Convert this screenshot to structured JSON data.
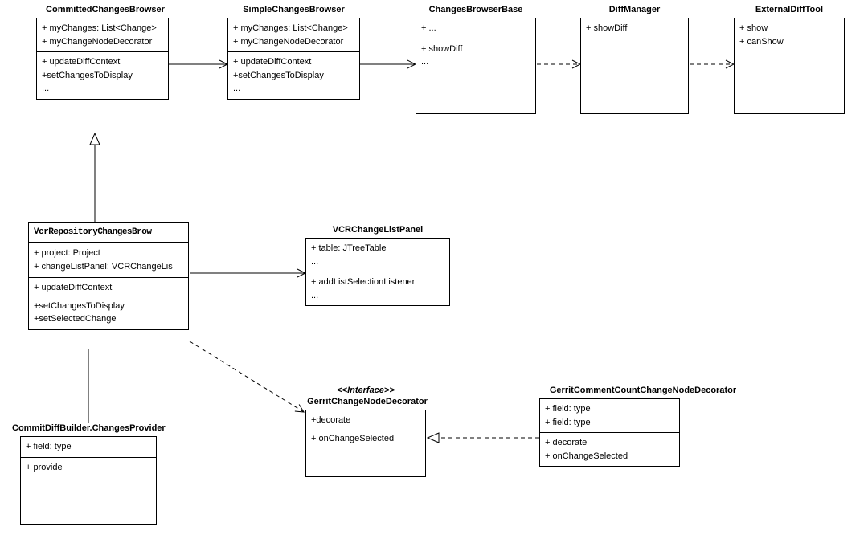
{
  "classes": {
    "committedChangesBrowser": {
      "title": "CommittedChangesBrowser",
      "attrs": [
        "+ myChanges: List<Change>",
        "+ myChangeNodeDecorator"
      ],
      "ops": [
        "+ updateDiffContext",
        "+setChangesToDisplay",
        "..."
      ]
    },
    "simpleChangesBrowser": {
      "title": "SimpleChangesBrowser",
      "attrs": [
        "+ myChanges: List<Change>",
        "+ myChangeNodeDecorator"
      ],
      "ops": [
        "+ updateDiffContext",
        "+setChangesToDisplay",
        "..."
      ]
    },
    "changesBrowserBase": {
      "title": "ChangesBrowserBase",
      "attrs": [
        "+ ..."
      ],
      "ops": [
        "+ showDiff",
        "..."
      ]
    },
    "diffManager": {
      "title": "DiffManager",
      "attrs": [],
      "ops": [
        "+ showDiff"
      ]
    },
    "externalDiffTool": {
      "title": "ExternalDiffTool",
      "attrs": [],
      "ops": [
        "+ show",
        "+ canShow"
      ]
    },
    "vcrRepoChangesBrowser": {
      "title": "VcrRepositoryChangesBrow",
      "attrs": [
        "+ project: Project",
        "+ changeListPanel: VCRChangeLis"
      ],
      "ops": [
        "+ updateDiffContext",
        "+setChangesToDisplay",
        "+setSelectedChange"
      ]
    },
    "vcrChangeListPanel": {
      "title": "VCRChangeListPanel",
      "attrs": [
        "+ table: JTreeTable",
        "..."
      ],
      "ops": [
        "+ addListSelectionListener",
        "..."
      ]
    },
    "commitDiffBuilder": {
      "title": "CommitDiffBuilder.ChangesProvider",
      "attrs": [
        "+ field: type"
      ],
      "ops": [
        "+ provide"
      ]
    },
    "gerritChangeNodeDecorator": {
      "stereotype": "<<Interface>>",
      "title": "GerritChangeNodeDecorator",
      "ops": [
        "+decorate",
        "+ onChangeSelected"
      ]
    },
    "gerritCommentCount": {
      "title": "GerritCommentCountChangeNodeDecorator",
      "attrs": [
        "+ field: type",
        "+ field: type"
      ],
      "ops": [
        "+ decorate",
        "+ onChangeSelected"
      ]
    }
  },
  "chart_data": {
    "type": "uml-class-diagram",
    "classes": [
      {
        "id": "CommittedChangesBrowser",
        "attributes": [
          "myChanges: List<Change>",
          "myChangeNodeDecorator"
        ],
        "operations": [
          "updateDiffContext",
          "setChangesToDisplay"
        ]
      },
      {
        "id": "SimpleChangesBrowser",
        "attributes": [
          "myChanges: List<Change>",
          "myChangeNodeDecorator"
        ],
        "operations": [
          "updateDiffContext",
          "setChangesToDisplay"
        ]
      },
      {
        "id": "ChangesBrowserBase",
        "attributes": [],
        "operations": [
          "showDiff"
        ]
      },
      {
        "id": "DiffManager",
        "attributes": [],
        "operations": [
          "showDiff"
        ]
      },
      {
        "id": "ExternalDiffTool",
        "attributes": [],
        "operations": [
          "show",
          "canShow"
        ]
      },
      {
        "id": "VcrRepositoryChangesBrowser",
        "attributes": [
          "project: Project",
          "changeListPanel: VCRChangeListPanel"
        ],
        "operations": [
          "updateDiffContext",
          "setChangesToDisplay",
          "setSelectedChange"
        ]
      },
      {
        "id": "VCRChangeListPanel",
        "attributes": [
          "table: JTreeTable"
        ],
        "operations": [
          "addListSelectionListener"
        ]
      },
      {
        "id": "CommitDiffBuilder.ChangesProvider",
        "attributes": [
          "field: type"
        ],
        "operations": [
          "provide"
        ]
      },
      {
        "id": "GerritChangeNodeDecorator",
        "stereotype": "Interface",
        "operations": [
          "decorate",
          "onChangeSelected"
        ]
      },
      {
        "id": "GerritCommentCountChangeNodeDecorator",
        "attributes": [
          "field: type",
          "field: type"
        ],
        "operations": [
          "decorate",
          "onChangeSelected"
        ]
      }
    ],
    "relationships": [
      {
        "from": "CommittedChangesBrowser",
        "to": "SimpleChangesBrowser",
        "type": "association",
        "style": "solid-open-arrow"
      },
      {
        "from": "SimpleChangesBrowser",
        "to": "ChangesBrowserBase",
        "type": "association",
        "style": "solid-open-arrow"
      },
      {
        "from": "ChangesBrowserBase",
        "to": "DiffManager",
        "type": "dependency",
        "style": "dashed-open-arrow"
      },
      {
        "from": "DiffManager",
        "to": "ExternalDiffTool",
        "type": "dependency",
        "style": "dashed-open-arrow"
      },
      {
        "from": "VcrRepositoryChangesBrowser",
        "to": "CommittedChangesBrowser",
        "type": "generalization",
        "style": "solid-hollow-triangle"
      },
      {
        "from": "VcrRepositoryChangesBrowser",
        "to": "VCRChangeListPanel",
        "type": "association",
        "style": "solid-open-arrow"
      },
      {
        "from": "VcrRepositoryChangesBrowser",
        "to": "CommitDiffBuilder.ChangesProvider",
        "type": "association",
        "style": "solid"
      },
      {
        "from": "VcrRepositoryChangesBrowser",
        "to": "GerritChangeNodeDecorator",
        "type": "dependency",
        "style": "dashed-open-arrow"
      },
      {
        "from": "GerritCommentCountChangeNodeDecorator",
        "to": "GerritChangeNodeDecorator",
        "type": "realization",
        "style": "dashed-hollow-triangle"
      }
    ]
  }
}
